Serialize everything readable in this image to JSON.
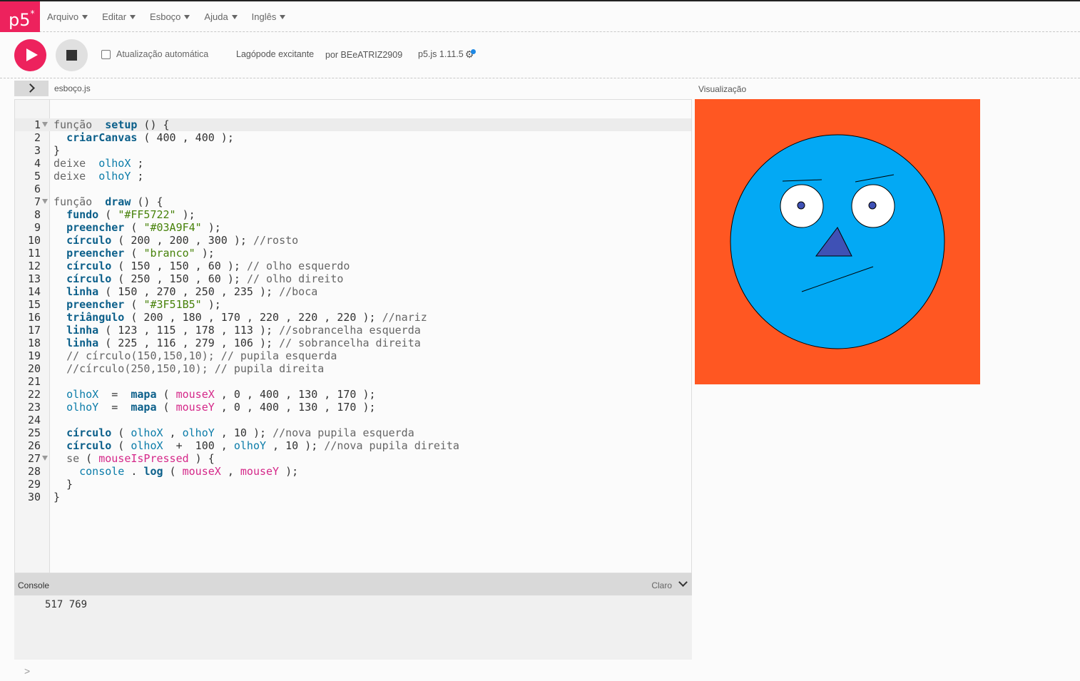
{
  "app": {
    "logo_text": "p5",
    "logo_sup": "*"
  },
  "menu": [
    {
      "label": "Arquivo"
    },
    {
      "label": "Editar"
    },
    {
      "label": "Esboço"
    },
    {
      "label": "Ajuda"
    },
    {
      "label": "Inglês"
    }
  ],
  "toolbar": {
    "autorefresh_label": "Atualização automática",
    "autorefresh_checked": false,
    "sketch_name": "Lagópode excitante",
    "author": "por BEeATRIZ2909",
    "version": "p5.js 1.11.5"
  },
  "file_tab": {
    "filename": "esboço.js"
  },
  "preview": {
    "label": "Visualização",
    "background": "#FF5722",
    "face_color": "#03A9F4",
    "eye_color": "#FFFFFF",
    "nose_color": "#3F51B5"
  },
  "console": {
    "title": "Console",
    "theme": "Claro",
    "messages": [
      "517 769"
    ],
    "prompt": ">"
  },
  "code_lines": [
    "função  setup () {",
    "  criarCanvas ( 400 , 400 );",
    "}",
    "deixe  olhoX ;",
    "deixe  olhoY ;",
    "",
    "função  draw () {",
    "  fundo ( \"#FF5722\" );",
    "  preencher ( \"#03A9F4\" );",
    "  círculo ( 200 , 200 , 300 ); //rosto",
    "  preencher ( \"branco\" );",
    "  círculo ( 150 , 150 , 60 ); // olho esquerdo",
    "  círculo ( 250 , 150 , 60 ); // olho direito",
    "  linha ( 150 , 270 , 250 , 235 ); //boca",
    "  preencher ( \"#3F51B5\" );",
    "  triângulo ( 200 , 180 , 170 , 220 , 220 , 220 ); //nariz",
    "  linha ( 123 , 115 , 178 , 113 ); //sobrancelha esquerda",
    "  linha ( 225 , 116 , 279 , 106 ); // sobrancelha direita",
    "  // círculo(150,150,10); // pupila esquerda",
    "  //círculo(250,150,10); // pupila direita",
    "",
    "  olhoX  =  mapa ( mouseX , 0 , 400 , 130 , 170 );",
    "  olhoY  =  mapa ( mouseY , 0 , 400 , 130 , 170 );",
    "",
    "  círculo ( olhoX , olhoY , 10 ); //nova pupila esquerda",
    "  círculo ( olhoX  +  100 , olhoY , 10 ); //nova pupila direita",
    "  se ( mouseIsPressed ) {",
    "    console . log ( mouseX , mouseY );",
    "  }",
    "}"
  ],
  "fold_lines": [
    1,
    7,
    27
  ]
}
